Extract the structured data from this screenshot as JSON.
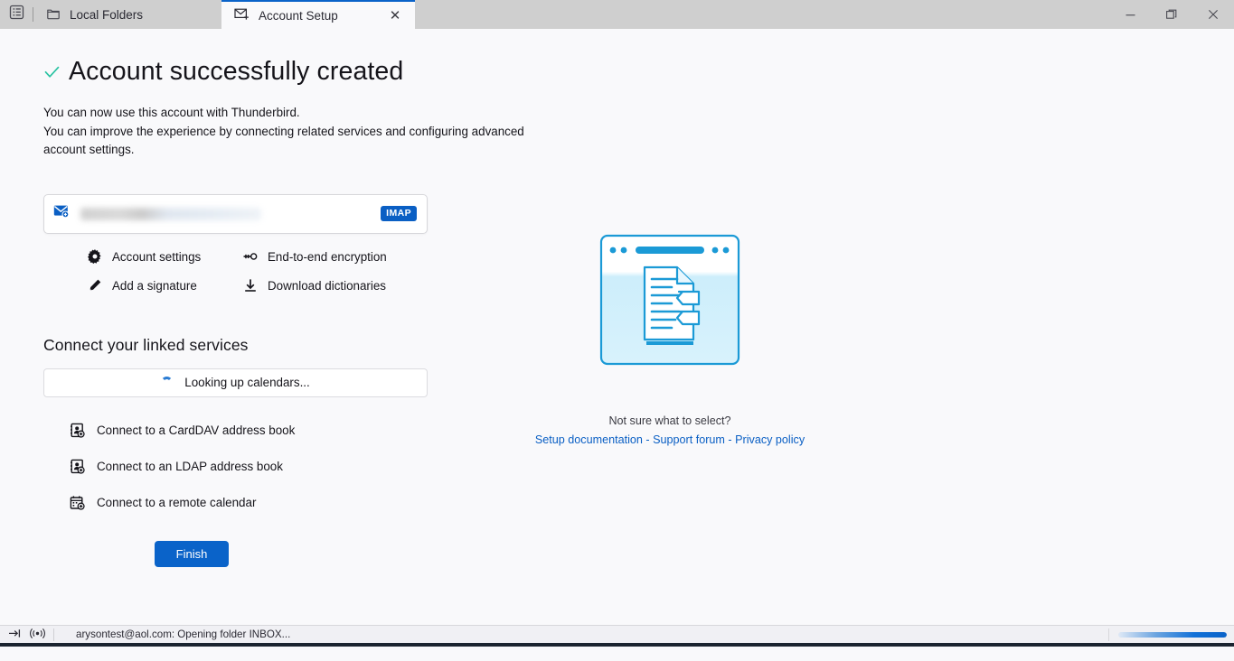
{
  "window": {
    "spaces_icon": "spaces-toolbar-icon",
    "minimize_label": "—",
    "restore_label": "restore-icon",
    "close_label": "✕"
  },
  "tabs": [
    {
      "label": "Local Folders",
      "icon": "folder-icon",
      "active": false,
      "closable": false
    },
    {
      "label": "Account Setup",
      "icon": "new-mail-account-icon",
      "active": true,
      "closable": true,
      "close_glyph": "✕"
    }
  ],
  "main": {
    "title": "Account successfully created",
    "check_icon": "checkmark-icon",
    "subtitle_line1": "You can now use this account with Thunderbird.",
    "subtitle_line2": "You can improve the experience by connecting related services and configuring advanced account settings.",
    "account_card": {
      "icon": "envelope-account-icon",
      "email": "",
      "email_redacted": true,
      "protocol_badge": "IMAP"
    },
    "account_actions": [
      {
        "label": "Account settings",
        "icon": "gear-icon"
      },
      {
        "label": "End-to-end encryption",
        "icon": "key-icon"
      },
      {
        "label": "Add a signature",
        "icon": "pencil-icon"
      },
      {
        "label": "Download dictionaries",
        "icon": "download-icon"
      }
    ],
    "linked_services_heading": "Connect your linked services",
    "lookup_status": "Looking up calendars...",
    "lookup_spinner_icon": "loading-spinner-icon",
    "connect_links": [
      {
        "label": "Connect to a CardDAV address book",
        "icon": "address-book-add-icon"
      },
      {
        "label": "Connect to an LDAP address book",
        "icon": "address-book-add-icon"
      },
      {
        "label": "Connect to a remote calendar",
        "icon": "calendar-add-icon"
      }
    ],
    "finish_button": "Finish"
  },
  "help": {
    "illustration_icon": "document-window-illustration",
    "prompt": "Not sure what to select?",
    "links": [
      {
        "label": "Setup documentation"
      },
      {
        "label": "Support forum"
      },
      {
        "label": "Privacy policy"
      }
    ],
    "separator": " - "
  },
  "statusbar": {
    "offline_icon": "go-offline-icon",
    "activity_icon": "network-activity-icon",
    "message": "arysontest@aol.com: Opening folder INBOX...",
    "progress_indeterminate": true
  },
  "colors": {
    "accent": "#0a63c9",
    "link": "#0a5fc4",
    "success": "#2ac3a2",
    "titlebar": "#cfcfcf",
    "content_bg": "#f9f9fb",
    "illustration": "#1b9ad6"
  }
}
